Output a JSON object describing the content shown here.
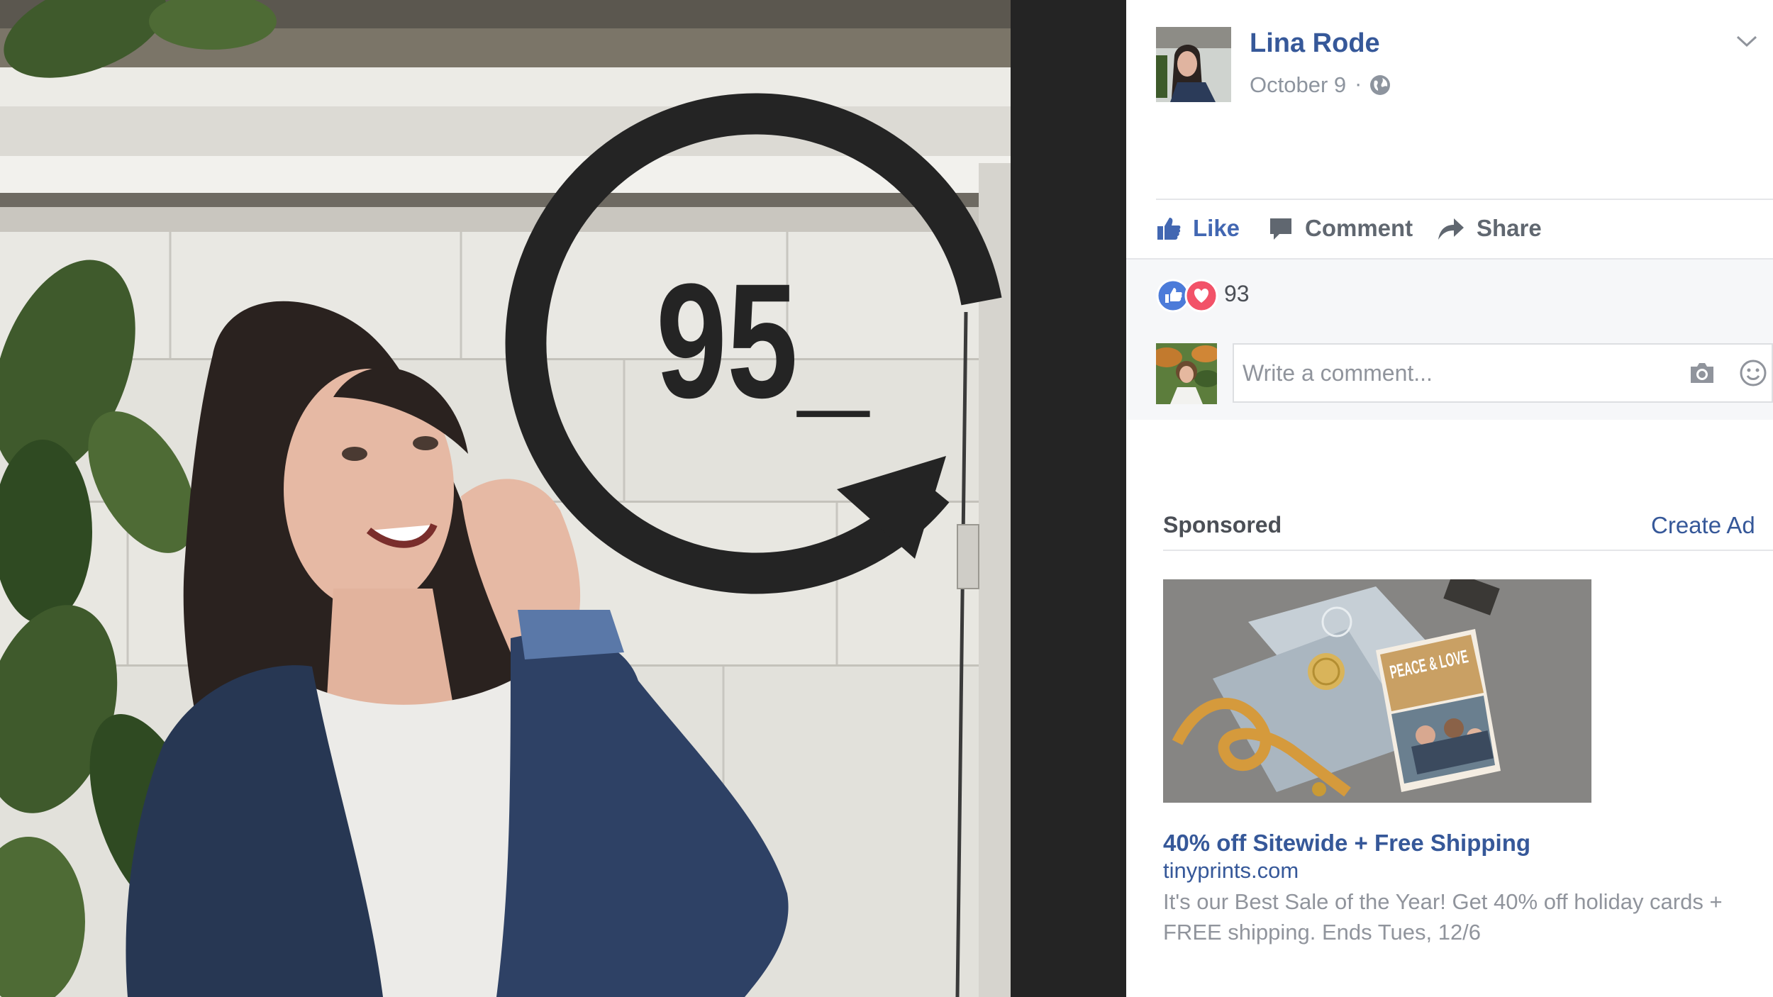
{
  "photo": {
    "overlay_text": "95_"
  },
  "post": {
    "author": "Lina Rode",
    "date": "October 9",
    "date_separator": "·",
    "privacy_icon": "globe-icon"
  },
  "actions": {
    "like": "Like",
    "comment": "Comment",
    "share": "Share"
  },
  "reactions": {
    "icons": [
      "like-reaction-icon",
      "love-reaction-icon"
    ],
    "count": "93"
  },
  "comment_box": {
    "placeholder": "Write a comment...",
    "icons": [
      "camera-icon",
      "smiley-icon"
    ]
  },
  "sidebar_ad": {
    "section_label": "Sponsored",
    "create_ad": "Create Ad",
    "image_text": "PEACE & LOVE",
    "title": "40% off Sitewide + Free Shipping",
    "domain": "tinyprints.com",
    "body": "It's our Best Sale of the Year! Get 40% off holiday cards + FREE shipping. Ends Tues, 12/6"
  },
  "colors": {
    "link_blue": "#365899",
    "like_blue": "#4267b2",
    "muted_gray": "#90949c",
    "gutter_dark": "#242424",
    "logo_black": "#242424",
    "love_red": "#f25268"
  }
}
